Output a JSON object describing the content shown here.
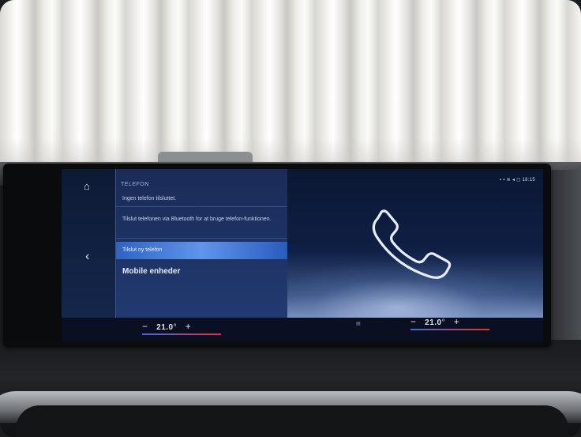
{
  "panel": {
    "title": "TELEFON",
    "rows": [
      "Ingen telefon tilsluttet.",
      "Tilslut telefonen via Bluetooth for at bruge telefon-funktionen.",
      "Tilslut ny telefon",
      "Mobile enheder"
    ]
  },
  "status_bar": "18:15",
  "climate": {
    "left": {
      "minus": "−",
      "temp": "21.0",
      "unit": "°",
      "plus": "+"
    },
    "right": {
      "minus": "−",
      "temp": "21.0",
      "unit": "°",
      "plus": "+"
    }
  },
  "icons": [
    "home-icon",
    "back-icon",
    "phone-icon"
  ]
}
